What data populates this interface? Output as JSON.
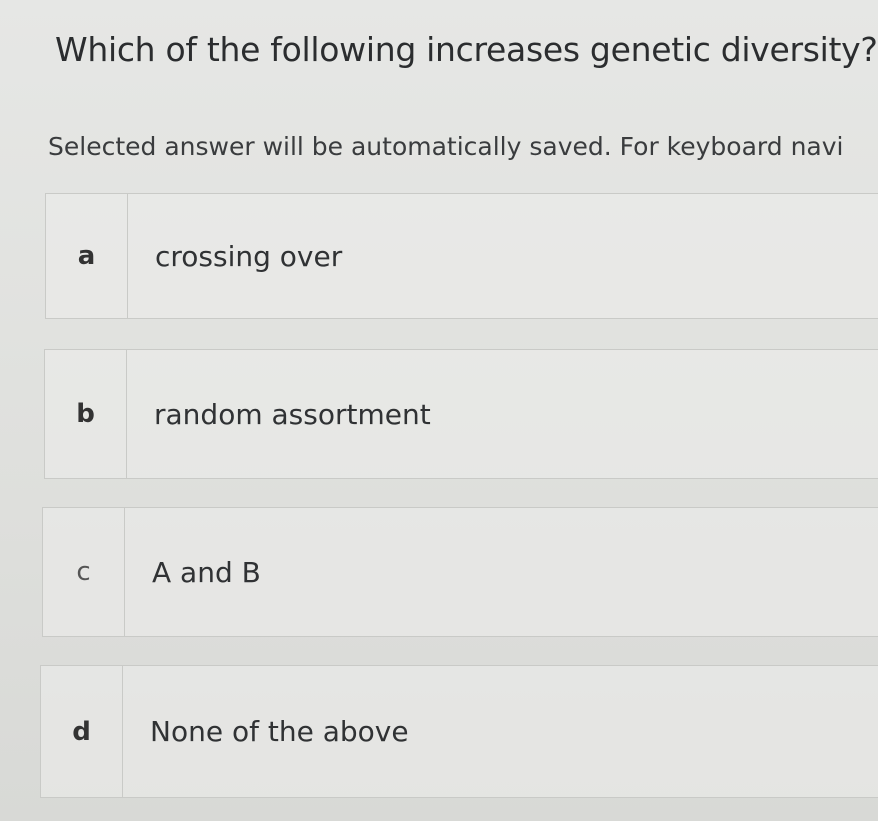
{
  "question": {
    "text": "Which of the following increases genetic diversity?"
  },
  "instructions": "Selected answer will be automatically saved. For keyboard navi",
  "options": [
    {
      "letter": "a",
      "text": "crossing over"
    },
    {
      "letter": "b",
      "text": "random assortment"
    },
    {
      "letter": "c",
      "text": "A and B"
    },
    {
      "letter": "d",
      "text": "None of the above"
    }
  ]
}
